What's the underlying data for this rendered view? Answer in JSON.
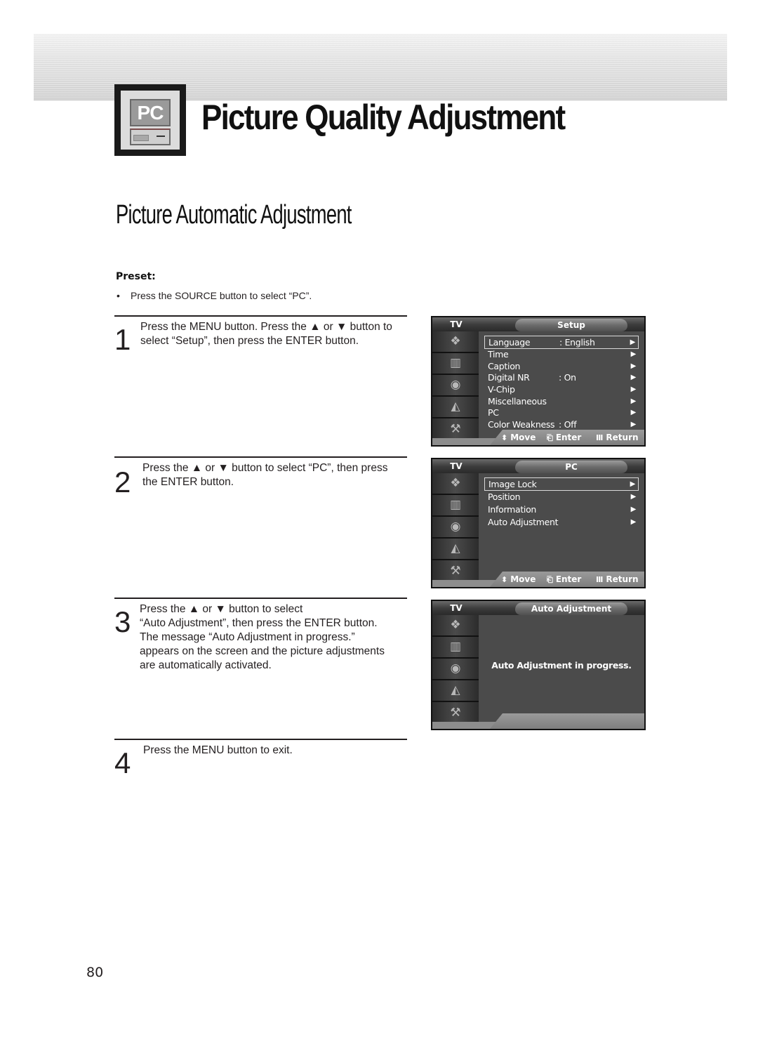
{
  "header": {
    "icon_label": "PC",
    "title": "Picture Quality Adjustment"
  },
  "section": {
    "title": "Picture Automatic Adjustment",
    "preset_label": "Preset:",
    "preset_bullet": "Press the SOURCE button to select “PC”."
  },
  "steps": [
    {
      "number": "1",
      "text": "Press the MENU button. Press the ▲ or ▼ button to\nselect “Setup”, then press the ENTER button."
    },
    {
      "number": "2",
      "text": "Press the ▲ or ▼ button to select “PC”, then press\nthe ENTER button."
    },
    {
      "number": "3",
      "text": "Press the ▲ or ▼ button to select\n“Auto Adjustment”, then press the ENTER button.\nThe message “Auto Adjustment in progress.”\nappears on the screen and the picture adjustments\nare automatically activated."
    },
    {
      "number": "4",
      "text": "Press the MENU button to exit."
    }
  ],
  "osd_common": {
    "tv_label": "TV",
    "sidebar_icons": [
      {
        "name": "input-icon",
        "glyph": "❖"
      },
      {
        "name": "picture-icon",
        "glyph": "▥"
      },
      {
        "name": "sound-icon",
        "glyph": "◉"
      },
      {
        "name": "channel-icon",
        "glyph": "◭"
      },
      {
        "name": "setup-icon",
        "glyph": "⚒"
      }
    ],
    "hints": {
      "move_icon": "⬍",
      "move": "Move",
      "enter_icon": "⎗",
      "enter": "Enter",
      "return_icon": "Ⅲ",
      "return": "Return"
    },
    "arrow": "▶"
  },
  "osd_setup": {
    "title": "Setup",
    "items": [
      {
        "label": "Language",
        "value": ": English",
        "selected": true
      },
      {
        "label": "Time",
        "value": ""
      },
      {
        "label": "Caption",
        "value": ""
      },
      {
        "label": "Digital NR",
        "value": ": On"
      },
      {
        "label": "V-Chip",
        "value": ""
      },
      {
        "label": "Miscellaneous",
        "value": ""
      },
      {
        "label": "PC",
        "value": ""
      },
      {
        "label": "Color Weakness",
        "value": ": Off"
      }
    ]
  },
  "osd_pc": {
    "title": "PC",
    "items": [
      {
        "label": "Image Lock",
        "selected": true
      },
      {
        "label": "Position"
      },
      {
        "label": "Information"
      },
      {
        "label": "Auto Adjustment"
      }
    ]
  },
  "osd_auto": {
    "title": "Auto Adjustment",
    "message": "Auto Adjustment in progress."
  },
  "page_number": "80"
}
